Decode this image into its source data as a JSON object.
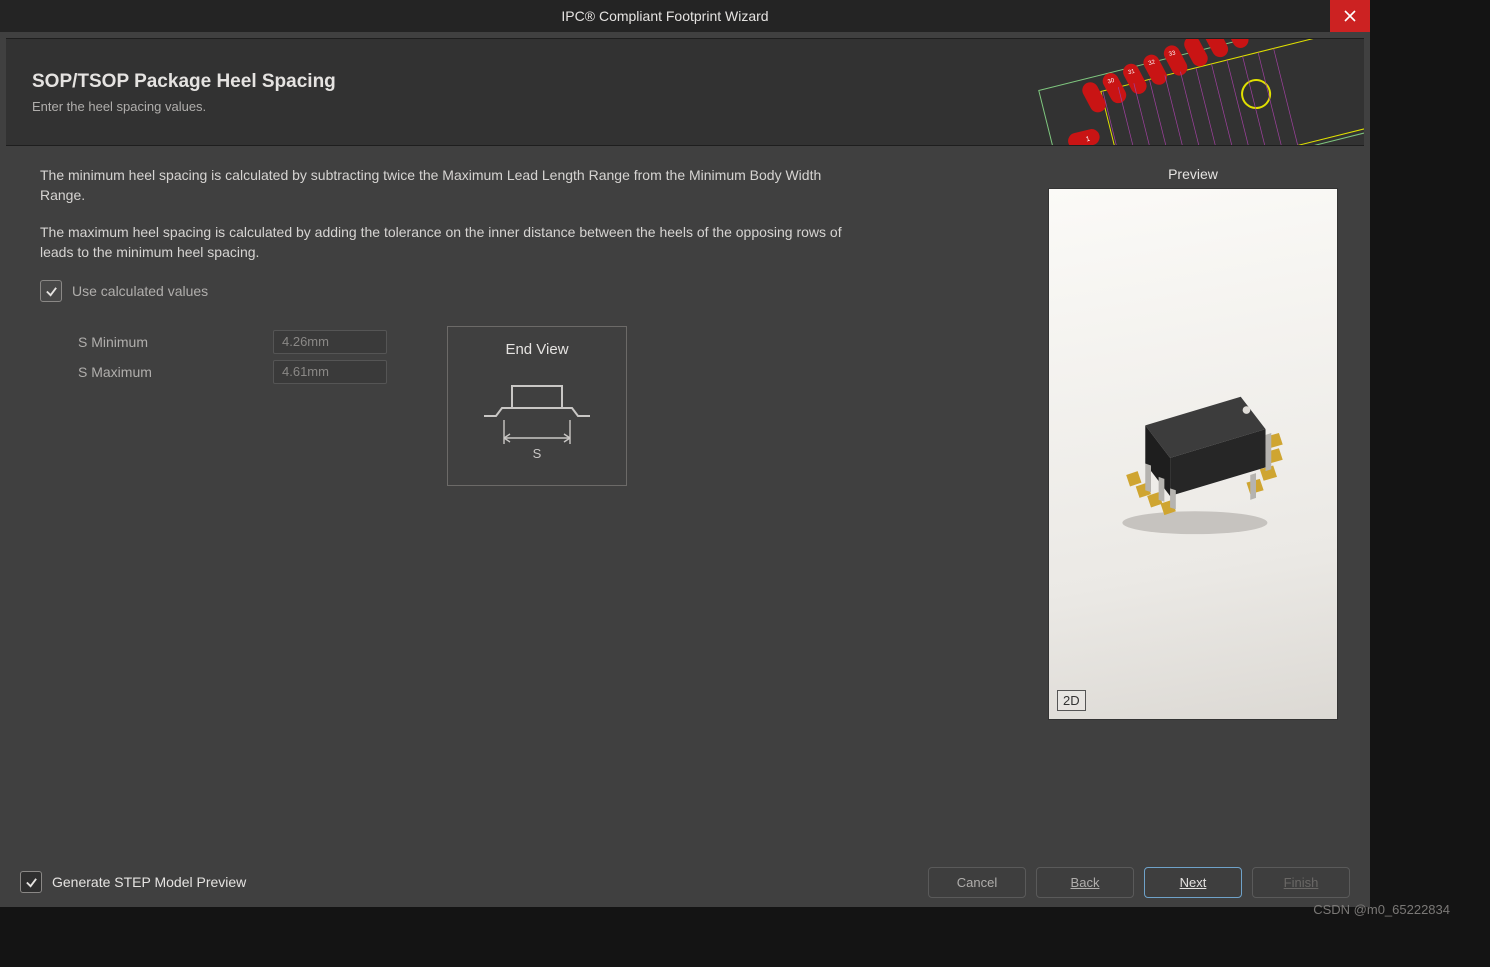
{
  "title": "IPC® Compliant Footprint Wizard",
  "banner": {
    "heading": "SOP/TSOP Package Heel Spacing",
    "subtitle": "Enter the heel spacing values."
  },
  "body": {
    "para1": "The minimum heel spacing is calculated by subtracting twice the Maximum Lead Length Range from the Minimum Body Width Range.",
    "para2": "The maximum heel spacing is calculated by adding the tolerance on the inner distance between the heels of the opposing rows of leads to the minimum heel spacing.",
    "use_calc_label": "Use calculated values",
    "use_calc_checked": true,
    "s_min_label": "S Minimum",
    "s_min_value": "4.26mm",
    "s_max_label": "S Maximum",
    "s_max_value": "4.61mm"
  },
  "diagram": {
    "caption": "End View",
    "dimension_label": "S"
  },
  "preview": {
    "heading": "Preview",
    "mode_button": "2D"
  },
  "footer": {
    "step_preview_label": "Generate STEP Model Preview",
    "step_preview_checked": true,
    "cancel": "Cancel",
    "back": "Back",
    "next": "Next",
    "finish": "Finish"
  },
  "watermark": "CSDN @m0_65222834"
}
